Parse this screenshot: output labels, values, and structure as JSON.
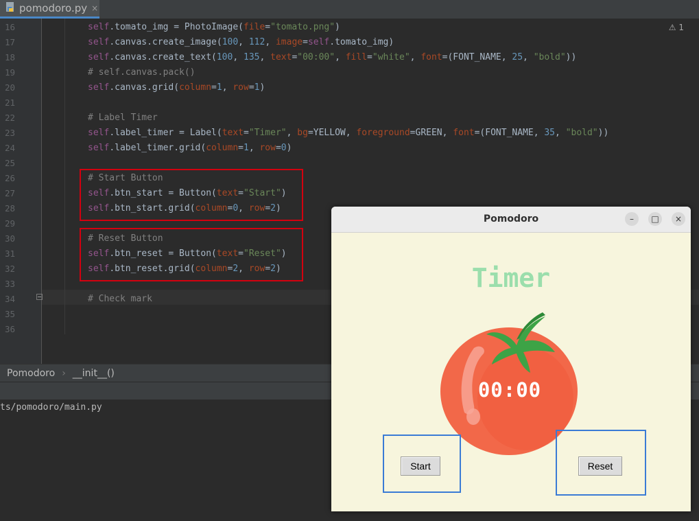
{
  "tab": {
    "filename": "pomodoro.py",
    "close": "×"
  },
  "editor": {
    "warning_count": "1",
    "lines": [
      {
        "n": "16",
        "segs": [
          [
            "kw",
            "self"
          ],
          [
            "plain",
            ".tomato_img = PhotoImage("
          ],
          [
            "prm",
            "file"
          ],
          [
            "plain",
            "="
          ],
          [
            "str",
            "\"tomato.png\""
          ],
          [
            "plain",
            ")"
          ]
        ]
      },
      {
        "n": "17",
        "segs": [
          [
            "kw",
            "self"
          ],
          [
            "plain",
            ".canvas.create_image("
          ],
          [
            "num",
            "100"
          ],
          [
            "plain",
            ", "
          ],
          [
            "num",
            "112"
          ],
          [
            "plain",
            ", "
          ],
          [
            "prm",
            "image"
          ],
          [
            "plain",
            "="
          ],
          [
            "kw",
            "self"
          ],
          [
            "plain",
            ".tomato_img)"
          ]
        ]
      },
      {
        "n": "18",
        "segs": [
          [
            "kw",
            "self"
          ],
          [
            "plain",
            ".canvas.create_text("
          ],
          [
            "num",
            "100"
          ],
          [
            "plain",
            ", "
          ],
          [
            "num",
            "135"
          ],
          [
            "plain",
            ", "
          ],
          [
            "prm",
            "text"
          ],
          [
            "plain",
            "="
          ],
          [
            "str",
            "\"00:00\""
          ],
          [
            "plain",
            ", "
          ],
          [
            "prm",
            "fill"
          ],
          [
            "plain",
            "="
          ],
          [
            "str",
            "\"white\""
          ],
          [
            "plain",
            ", "
          ],
          [
            "prm",
            "font"
          ],
          [
            "plain",
            "=(FONT_NAME, "
          ],
          [
            "num",
            "25"
          ],
          [
            "plain",
            ", "
          ],
          [
            "str",
            "\"bold\""
          ],
          [
            "plain",
            "))"
          ]
        ]
      },
      {
        "n": "19",
        "segs": [
          [
            "cmt",
            "# self.canvas.pack()"
          ]
        ]
      },
      {
        "n": "20",
        "segs": [
          [
            "kw",
            "self"
          ],
          [
            "plain",
            ".canvas.grid("
          ],
          [
            "prm",
            "column"
          ],
          [
            "plain",
            "="
          ],
          [
            "num",
            "1"
          ],
          [
            "plain",
            ", "
          ],
          [
            "prm",
            "row"
          ],
          [
            "plain",
            "="
          ],
          [
            "num",
            "1"
          ],
          [
            "plain",
            ")"
          ]
        ]
      },
      {
        "n": "21",
        "segs": []
      },
      {
        "n": "22",
        "segs": [
          [
            "cmt",
            "# Label Timer"
          ]
        ]
      },
      {
        "n": "23",
        "segs": [
          [
            "kw",
            "self"
          ],
          [
            "plain",
            ".label_timer = Label("
          ],
          [
            "prm",
            "text"
          ],
          [
            "plain",
            "="
          ],
          [
            "str",
            "\"Timer\""
          ],
          [
            "plain",
            ", "
          ],
          [
            "prm",
            "bg"
          ],
          [
            "plain",
            "=YELLOW, "
          ],
          [
            "prm",
            "foreground"
          ],
          [
            "plain",
            "=GREEN, "
          ],
          [
            "prm",
            "font"
          ],
          [
            "plain",
            "=(FONT_NAME, "
          ],
          [
            "num",
            "35"
          ],
          [
            "plain",
            ", "
          ],
          [
            "str",
            "\"bold\""
          ],
          [
            "plain",
            "))"
          ]
        ]
      },
      {
        "n": "24",
        "segs": [
          [
            "kw",
            "self"
          ],
          [
            "plain",
            ".label_timer.grid("
          ],
          [
            "prm",
            "column"
          ],
          [
            "plain",
            "="
          ],
          [
            "num",
            "1"
          ],
          [
            "plain",
            ", "
          ],
          [
            "prm",
            "row"
          ],
          [
            "plain",
            "="
          ],
          [
            "num",
            "0"
          ],
          [
            "plain",
            ")"
          ]
        ]
      },
      {
        "n": "25",
        "segs": []
      },
      {
        "n": "26",
        "segs": [
          [
            "cmt",
            "# Start Button"
          ]
        ]
      },
      {
        "n": "27",
        "segs": [
          [
            "kw",
            "self"
          ],
          [
            "plain",
            ".btn_start = Button("
          ],
          [
            "prm",
            "text"
          ],
          [
            "plain",
            "="
          ],
          [
            "str",
            "\"Start\""
          ],
          [
            "plain",
            ")"
          ]
        ]
      },
      {
        "n": "28",
        "segs": [
          [
            "kw",
            "self"
          ],
          [
            "plain",
            ".btn_start.grid("
          ],
          [
            "prm",
            "column"
          ],
          [
            "plain",
            "="
          ],
          [
            "num",
            "0"
          ],
          [
            "plain",
            ", "
          ],
          [
            "prm",
            "row"
          ],
          [
            "plain",
            "="
          ],
          [
            "num",
            "2"
          ],
          [
            "plain",
            ")"
          ]
        ]
      },
      {
        "n": "29",
        "segs": []
      },
      {
        "n": "30",
        "segs": [
          [
            "cmt",
            "# Reset Button"
          ]
        ]
      },
      {
        "n": "31",
        "segs": [
          [
            "kw",
            "self"
          ],
          [
            "plain",
            ".btn_reset = Button("
          ],
          [
            "prm",
            "text"
          ],
          [
            "plain",
            "="
          ],
          [
            "str",
            "\"Reset\""
          ],
          [
            "plain",
            ")"
          ]
        ]
      },
      {
        "n": "32",
        "segs": [
          [
            "kw",
            "self"
          ],
          [
            "plain",
            ".btn_reset.grid("
          ],
          [
            "prm",
            "column"
          ],
          [
            "plain",
            "="
          ],
          [
            "num",
            "2"
          ],
          [
            "plain",
            ", "
          ],
          [
            "prm",
            "row"
          ],
          [
            "plain",
            "="
          ],
          [
            "num",
            "2"
          ],
          [
            "plain",
            ")"
          ]
        ]
      },
      {
        "n": "33",
        "segs": []
      },
      {
        "n": "34",
        "segs": [
          [
            "cmt",
            "# Check mark"
          ]
        ]
      },
      {
        "n": "35",
        "segs": []
      },
      {
        "n": "36",
        "segs": []
      }
    ]
  },
  "breadcrumb": {
    "item1": "Pomodoro",
    "sep": "›",
    "item2": "__init__()"
  },
  "console": {
    "line": "ts/pomodoro/main.py"
  },
  "app_window": {
    "title": "Pomodoro",
    "timer_label": "Timer",
    "time_text": "00:00",
    "start_label": "Start",
    "reset_label": "Reset",
    "minimize": "–",
    "maximize": "□",
    "close": "×"
  },
  "colors": {
    "highlight_red": "#d3000f",
    "highlight_blue": "#3a7bd5",
    "timer_green": "#9bdeac",
    "window_bg": "#f7f5dd",
    "tomato": "#f26849"
  }
}
